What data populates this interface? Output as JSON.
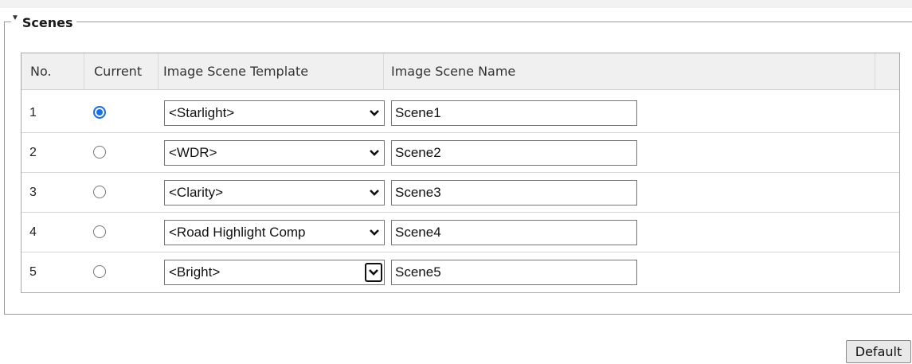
{
  "section": {
    "title": "Scenes"
  },
  "table": {
    "headers": {
      "no": "No.",
      "current": "Current",
      "template": "Image Scene Template",
      "name": "Image Scene Name"
    },
    "rows": [
      {
        "no": "1",
        "current": true,
        "template": "<Starlight>",
        "name": "Scene1"
      },
      {
        "no": "2",
        "current": false,
        "template": "<WDR>",
        "name": "Scene2"
      },
      {
        "no": "3",
        "current": false,
        "template": "<Clarity>",
        "name": "Scene3"
      },
      {
        "no": "4",
        "current": false,
        "template": "<Road Highlight Comp",
        "name": "Scene4"
      },
      {
        "no": "5",
        "current": false,
        "template": "<Bright>",
        "name": "Scene5"
      }
    ]
  },
  "buttons": {
    "default_label": "Default"
  },
  "icons": {
    "collapse": "caret-down-icon",
    "dropdown": "chevron-down-icon"
  },
  "colors": {
    "radio_checked": "#1a6fe6",
    "header_bg": "#f0f0f0"
  }
}
